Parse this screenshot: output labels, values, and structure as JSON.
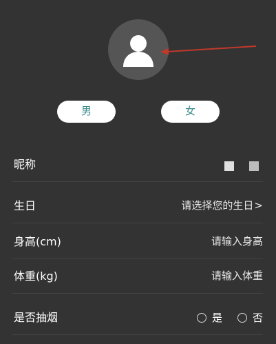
{
  "profile": {
    "avatar_icon": "user-icon",
    "gender_male_label": "男",
    "gender_female_label": "女"
  },
  "rows": {
    "nickname": {
      "label": "昵称"
    },
    "birthday": {
      "label": "生日",
      "value": "请选择您的生日",
      "chevron": ">"
    },
    "height": {
      "label": "身高(cm)",
      "value": "请输入身高"
    },
    "weight": {
      "label": "体重(kg)",
      "value": "请输入体重"
    },
    "smoking": {
      "label": "是否抽烟",
      "yes_label": "是",
      "no_label": "否"
    }
  },
  "colors": {
    "background": "#333333",
    "avatar_bg": "#555555",
    "gender_text": "#3a8a8a",
    "arrow": "#c0392b"
  }
}
